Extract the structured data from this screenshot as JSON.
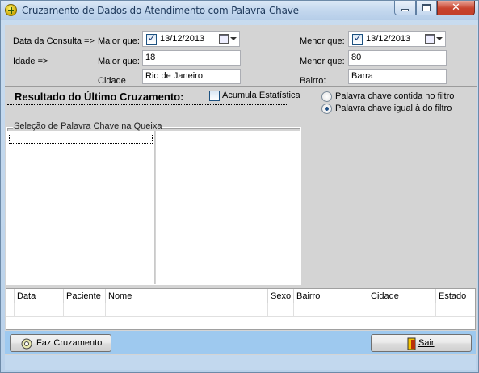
{
  "window": {
    "title": "Cruzamento de Dados do Atendimento com Palavra-Chave",
    "controls": {
      "close": "✕"
    }
  },
  "filters": {
    "data_label": "Data da Consulta =>",
    "maior_que_label": "Maior que:",
    "menor_que_label": "Menor que:",
    "data_from": {
      "checked": true,
      "value": "13/12/2013"
    },
    "data_to": {
      "checked": true,
      "value": "13/12/2013"
    },
    "idade_label": "Idade =>",
    "idade_maior": "18",
    "idade_menor": "80",
    "cidade_label": "Cidade",
    "cidade_value": "Rio de Janeiro",
    "bairro_label": "Bairro:",
    "bairro_value": "Barra"
  },
  "result": {
    "title": "Resultado do Último Cruzamento:",
    "acumula_label": "Acumula Estatística",
    "acumula_checked": false,
    "radio_options": [
      {
        "label": "Palavra chave contida no filtro",
        "selected": false
      },
      {
        "label": "Palavra chave igual à do filtro",
        "selected": true
      }
    ]
  },
  "keywords": {
    "legend": "Seleção de Palavra Chave na Queixa"
  },
  "grid": {
    "columns": [
      "Data",
      "Paciente",
      "Nome",
      "Sexo",
      "Bairro",
      "Cidade",
      "Estado"
    ]
  },
  "buttons": {
    "faz_cruzamento": "Faz Cruzamento",
    "sair": "Sair"
  }
}
